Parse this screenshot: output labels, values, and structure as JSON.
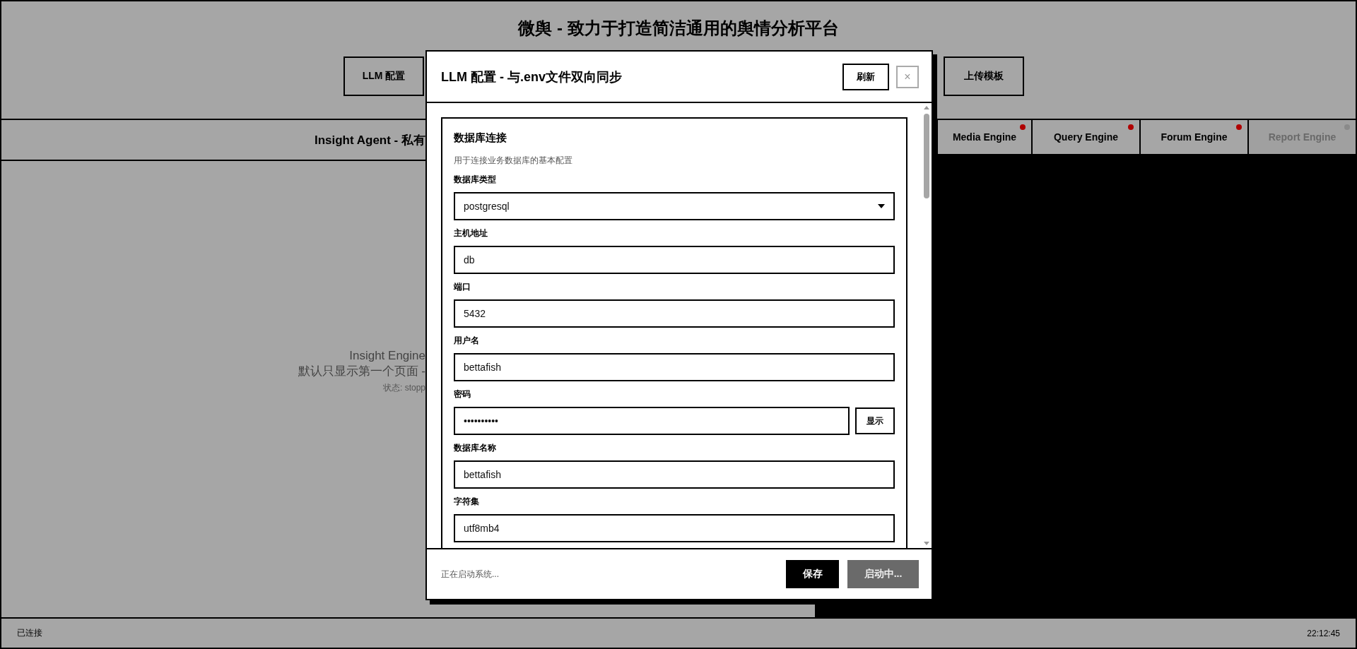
{
  "header": {
    "title": "微舆 - 致力于打造简洁通用的舆情分析平台",
    "buttons": [
      "LLM 配置",
      "上传模板"
    ]
  },
  "left_panel": {
    "title": "Insight Agent - 私有",
    "lines": [
      "Insight Engine",
      "默认只显示第一个页面 -",
      "状态: stopp"
    ]
  },
  "engine_tabs": [
    {
      "label": "Media Engine",
      "disabled": false,
      "color": "#b00000"
    },
    {
      "label": "Query Engine",
      "disabled": false,
      "color": "#b00000"
    },
    {
      "label": "Forum Engine",
      "disabled": false,
      "color": "#b00000"
    },
    {
      "label": "Report Engine",
      "disabled": true,
      "color": "#8a8a8a"
    }
  ],
  "modal": {
    "title": "LLM 配置 - 与.env文件双向同步",
    "refresh": "刷新",
    "close": "×",
    "section": {
      "title": "数据库连接",
      "description": "用于连接业务数据库的基本配置",
      "fields": [
        {
          "kind": "select",
          "label": "数据库类型",
          "value": "postgresql"
        },
        {
          "kind": "text",
          "label": "主机地址",
          "value": "db"
        },
        {
          "kind": "text",
          "label": "端口",
          "value": "5432"
        },
        {
          "kind": "text",
          "label": "用户名",
          "value": "bettafish"
        },
        {
          "kind": "password",
          "label": "密码",
          "value": "••••••••••",
          "toggle": "显示"
        },
        {
          "kind": "text",
          "label": "数据库名称",
          "value": "bettafish"
        },
        {
          "kind": "text",
          "label": "字符集",
          "value": "utf8mb4"
        }
      ]
    },
    "status": "正在启动系统...",
    "save": "保存",
    "start": "启动中...",
    "start_disabled": true
  },
  "status_bar": {
    "connection": "已连接",
    "time": "22:12:45"
  }
}
